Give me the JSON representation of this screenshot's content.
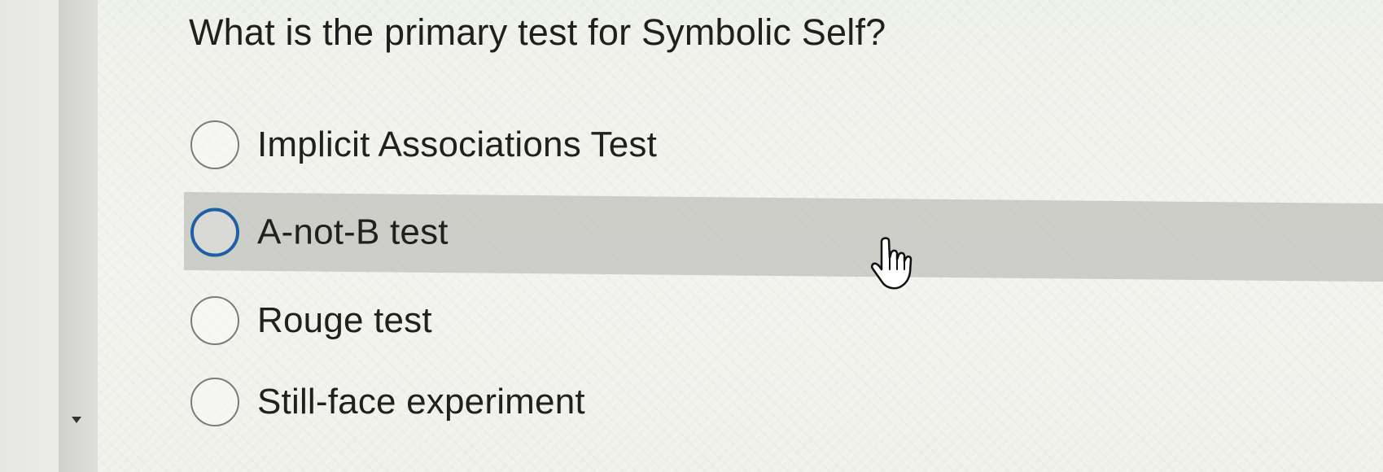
{
  "question": {
    "text": "What is the primary test for Symbolic Self?"
  },
  "options": [
    {
      "label": "Implicit Associations Test",
      "selected": false,
      "hovered": false
    },
    {
      "label": "A-not-B test",
      "selected": false,
      "hovered": true
    },
    {
      "label": "Rouge test",
      "selected": false,
      "hovered": false
    },
    {
      "label": "Still-face experiment",
      "selected": false,
      "hovered": false
    }
  ],
  "icons": {
    "cursor": "pointer-hand-icon",
    "scroll_arrow": "chevron-down-icon"
  },
  "colors": {
    "accent": "#1f5fa3",
    "hover_row": "#b4b7b2"
  }
}
